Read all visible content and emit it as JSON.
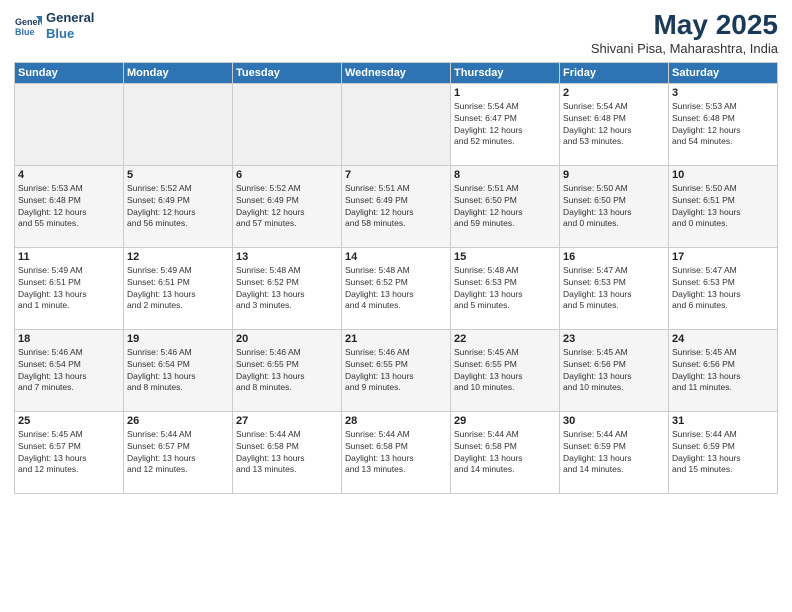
{
  "header": {
    "logo_line1": "General",
    "logo_line2": "Blue",
    "month": "May 2025",
    "location": "Shivani Pisa, Maharashtra, India"
  },
  "weekdays": [
    "Sunday",
    "Monday",
    "Tuesday",
    "Wednesday",
    "Thursday",
    "Friday",
    "Saturday"
  ],
  "weeks": [
    [
      {
        "day": "",
        "info": ""
      },
      {
        "day": "",
        "info": ""
      },
      {
        "day": "",
        "info": ""
      },
      {
        "day": "",
        "info": ""
      },
      {
        "day": "1",
        "info": "Sunrise: 5:54 AM\nSunset: 6:47 PM\nDaylight: 12 hours\nand 52 minutes."
      },
      {
        "day": "2",
        "info": "Sunrise: 5:54 AM\nSunset: 6:48 PM\nDaylight: 12 hours\nand 53 minutes."
      },
      {
        "day": "3",
        "info": "Sunrise: 5:53 AM\nSunset: 6:48 PM\nDaylight: 12 hours\nand 54 minutes."
      }
    ],
    [
      {
        "day": "4",
        "info": "Sunrise: 5:53 AM\nSunset: 6:48 PM\nDaylight: 12 hours\nand 55 minutes."
      },
      {
        "day": "5",
        "info": "Sunrise: 5:52 AM\nSunset: 6:49 PM\nDaylight: 12 hours\nand 56 minutes."
      },
      {
        "day": "6",
        "info": "Sunrise: 5:52 AM\nSunset: 6:49 PM\nDaylight: 12 hours\nand 57 minutes."
      },
      {
        "day": "7",
        "info": "Sunrise: 5:51 AM\nSunset: 6:49 PM\nDaylight: 12 hours\nand 58 minutes."
      },
      {
        "day": "8",
        "info": "Sunrise: 5:51 AM\nSunset: 6:50 PM\nDaylight: 12 hours\nand 59 minutes."
      },
      {
        "day": "9",
        "info": "Sunrise: 5:50 AM\nSunset: 6:50 PM\nDaylight: 13 hours\nand 0 minutes."
      },
      {
        "day": "10",
        "info": "Sunrise: 5:50 AM\nSunset: 6:51 PM\nDaylight: 13 hours\nand 0 minutes."
      }
    ],
    [
      {
        "day": "11",
        "info": "Sunrise: 5:49 AM\nSunset: 6:51 PM\nDaylight: 13 hours\nand 1 minute."
      },
      {
        "day": "12",
        "info": "Sunrise: 5:49 AM\nSunset: 6:51 PM\nDaylight: 13 hours\nand 2 minutes."
      },
      {
        "day": "13",
        "info": "Sunrise: 5:48 AM\nSunset: 6:52 PM\nDaylight: 13 hours\nand 3 minutes."
      },
      {
        "day": "14",
        "info": "Sunrise: 5:48 AM\nSunset: 6:52 PM\nDaylight: 13 hours\nand 4 minutes."
      },
      {
        "day": "15",
        "info": "Sunrise: 5:48 AM\nSunset: 6:53 PM\nDaylight: 13 hours\nand 5 minutes."
      },
      {
        "day": "16",
        "info": "Sunrise: 5:47 AM\nSunset: 6:53 PM\nDaylight: 13 hours\nand 5 minutes."
      },
      {
        "day": "17",
        "info": "Sunrise: 5:47 AM\nSunset: 6:53 PM\nDaylight: 13 hours\nand 6 minutes."
      }
    ],
    [
      {
        "day": "18",
        "info": "Sunrise: 5:46 AM\nSunset: 6:54 PM\nDaylight: 13 hours\nand 7 minutes."
      },
      {
        "day": "19",
        "info": "Sunrise: 5:46 AM\nSunset: 6:54 PM\nDaylight: 13 hours\nand 8 minutes."
      },
      {
        "day": "20",
        "info": "Sunrise: 5:46 AM\nSunset: 6:55 PM\nDaylight: 13 hours\nand 8 minutes."
      },
      {
        "day": "21",
        "info": "Sunrise: 5:46 AM\nSunset: 6:55 PM\nDaylight: 13 hours\nand 9 minutes."
      },
      {
        "day": "22",
        "info": "Sunrise: 5:45 AM\nSunset: 6:55 PM\nDaylight: 13 hours\nand 10 minutes."
      },
      {
        "day": "23",
        "info": "Sunrise: 5:45 AM\nSunset: 6:56 PM\nDaylight: 13 hours\nand 10 minutes."
      },
      {
        "day": "24",
        "info": "Sunrise: 5:45 AM\nSunset: 6:56 PM\nDaylight: 13 hours\nand 11 minutes."
      }
    ],
    [
      {
        "day": "25",
        "info": "Sunrise: 5:45 AM\nSunset: 6:57 PM\nDaylight: 13 hours\nand 12 minutes."
      },
      {
        "day": "26",
        "info": "Sunrise: 5:44 AM\nSunset: 6:57 PM\nDaylight: 13 hours\nand 12 minutes."
      },
      {
        "day": "27",
        "info": "Sunrise: 5:44 AM\nSunset: 6:58 PM\nDaylight: 13 hours\nand 13 minutes."
      },
      {
        "day": "28",
        "info": "Sunrise: 5:44 AM\nSunset: 6:58 PM\nDaylight: 13 hours\nand 13 minutes."
      },
      {
        "day": "29",
        "info": "Sunrise: 5:44 AM\nSunset: 6:58 PM\nDaylight: 13 hours\nand 14 minutes."
      },
      {
        "day": "30",
        "info": "Sunrise: 5:44 AM\nSunset: 6:59 PM\nDaylight: 13 hours\nand 14 minutes."
      },
      {
        "day": "31",
        "info": "Sunrise: 5:44 AM\nSunset: 6:59 PM\nDaylight: 13 hours\nand 15 minutes."
      }
    ]
  ]
}
